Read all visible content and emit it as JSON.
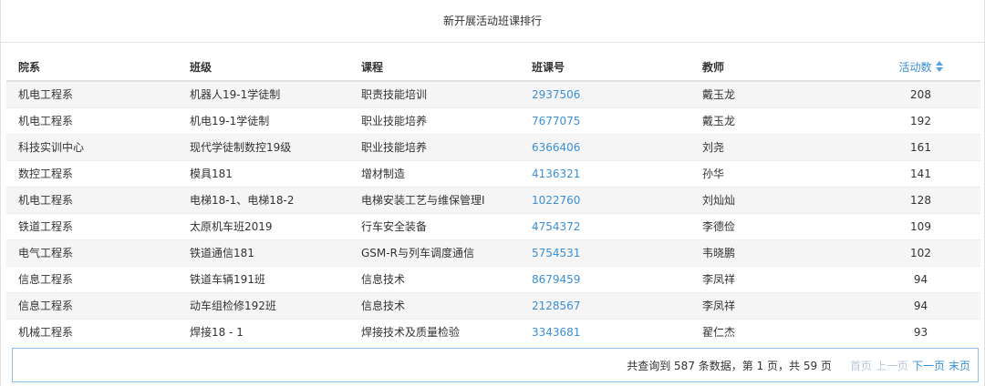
{
  "panel": {
    "title": "新开展活动班课排行"
  },
  "table": {
    "columns": [
      "院系",
      "班级",
      "课程",
      "班课号",
      "教师",
      "活动数"
    ],
    "rows": [
      [
        "机电工程系",
        "机器人19-1学徒制",
        "职责技能培训",
        "2937506",
        "戴玉龙",
        "208"
      ],
      [
        "机电工程系",
        "机电19-1学徒制",
        "职业技能培养",
        "7677075",
        "戴玉龙",
        "192"
      ],
      [
        "科技实训中心",
        "现代学徒制数控19级",
        "职业技能培养",
        "6366406",
        "刘尧",
        "161"
      ],
      [
        "数控工程系",
        "模具181",
        "增材制造",
        "4136321",
        "孙华",
        "141"
      ],
      [
        "机电工程系",
        "电梯18-1、电梯18-2",
        "电梯安装工艺与维保管理Ⅰ",
        "1022760",
        "刘灿灿",
        "128"
      ],
      [
        "铁道工程系",
        "太原机车班2019",
        "行车安全装备",
        "4754372",
        "李德俭",
        "109"
      ],
      [
        "电气工程系",
        "铁道通信181",
        "GSM-R与列车调度通信",
        "5754531",
        "韦晓鹏",
        "102"
      ],
      [
        "信息工程系",
        "铁道车辆191班",
        "信息技术",
        "8679459",
        "李凤祥",
        "94"
      ],
      [
        "信息工程系",
        "动车组检修192班",
        "信息技术",
        "2128567",
        "李凤祥",
        "94"
      ],
      [
        "机械工程系",
        "焊接18 - 1",
        "焊接技术及质量检验",
        "3343681",
        "翟仁杰",
        "93"
      ]
    ]
  },
  "pagination": {
    "summary": "共查询到 587 条数据，第 1 页，共 59 页",
    "first": "首页",
    "prev": "上一页",
    "next": "下一页",
    "last": "末页"
  },
  "colors": {
    "link": "#3b8fd5",
    "disabled": "#bcc9d6",
    "border": "#8cc0ea",
    "stripe": "#f5f5f5"
  }
}
